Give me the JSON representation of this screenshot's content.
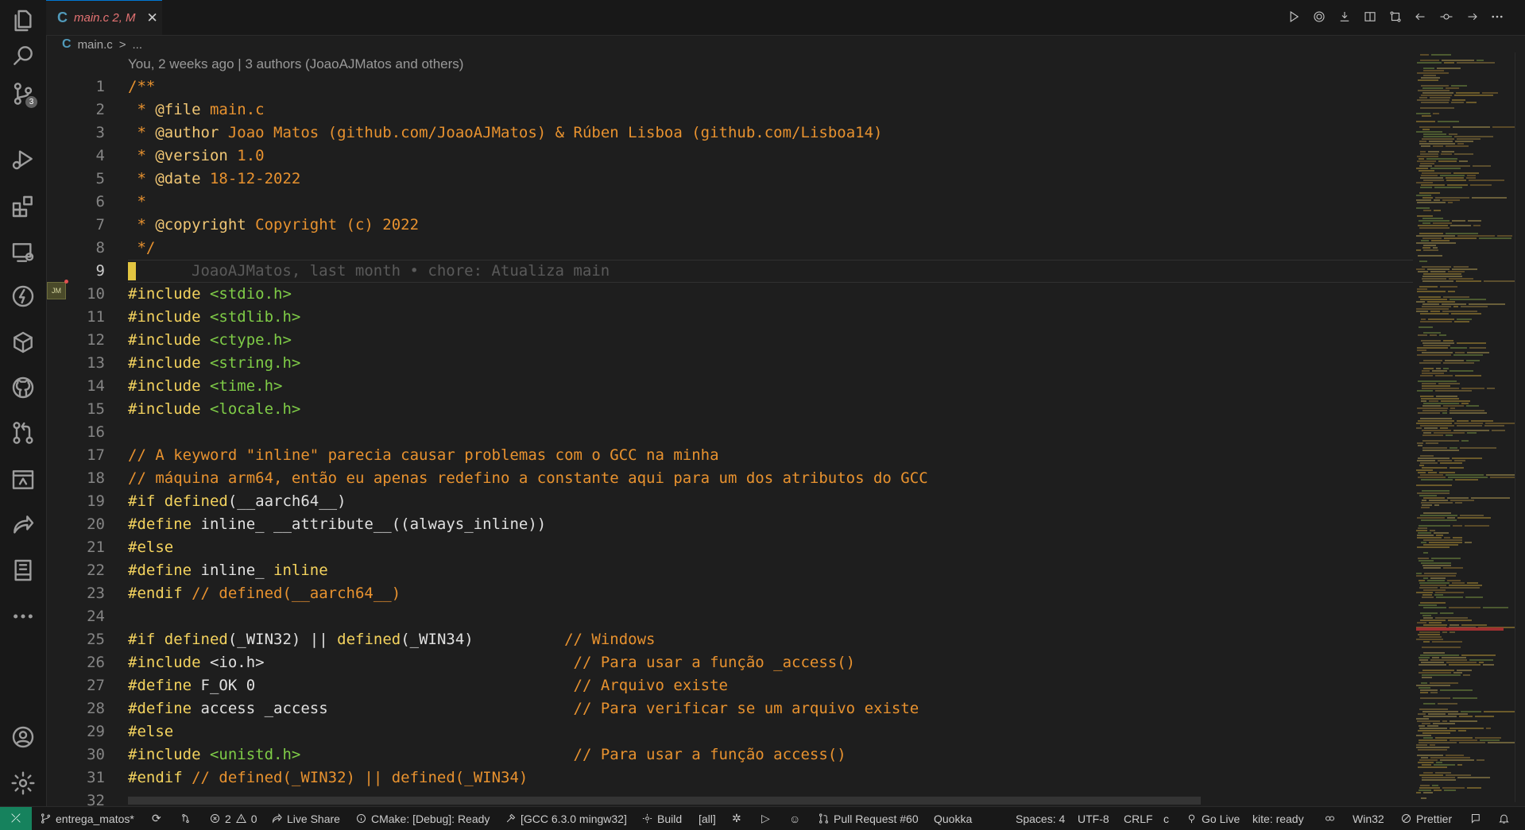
{
  "activity_bar": {
    "scm_badge": "3"
  },
  "tab": {
    "label": "main.c 2, M",
    "icon_glyph": "C",
    "close_glyph": "✕"
  },
  "breadcrumb": {
    "icon_glyph": "C",
    "file": "main.c",
    "separator": ">",
    "rest": "..."
  },
  "blame_header": "You, 2 weeks ago | 3 authors (JoaoAJMatos and others)",
  "inline_blame": "JoaoAJMatos, last month • chore: Atualiza main",
  "gutter_avatar": "JM",
  "code_lines": [
    {
      "n": "1",
      "segments": [
        {
          "t": "/**",
          "c": "cmt"
        }
      ]
    },
    {
      "n": "2",
      "segments": [
        {
          "t": " * ",
          "c": "cmt"
        },
        {
          "t": "@file",
          "c": "kw"
        },
        {
          "t": " main.c",
          "c": "cmt"
        }
      ]
    },
    {
      "n": "3",
      "segments": [
        {
          "t": " * ",
          "c": "cmt"
        },
        {
          "t": "@author",
          "c": "kw"
        },
        {
          "t": " Joao Matos (github.com/JoaoAJMatos) & Rúben Lisboa (github.com/Lisboa14)",
          "c": "cmt"
        }
      ]
    },
    {
      "n": "4",
      "segments": [
        {
          "t": " * ",
          "c": "cmt"
        },
        {
          "t": "@version",
          "c": "kw"
        },
        {
          "t": " 1.0",
          "c": "cmt"
        }
      ]
    },
    {
      "n": "5",
      "segments": [
        {
          "t": " * ",
          "c": "cmt"
        },
        {
          "t": "@date",
          "c": "kw"
        },
        {
          "t": " 18-12-2022",
          "c": "cmt"
        }
      ]
    },
    {
      "n": "6",
      "segments": [
        {
          "t": " *",
          "c": "cmt"
        }
      ]
    },
    {
      "n": "7",
      "segments": [
        {
          "t": " * ",
          "c": "cmt"
        },
        {
          "t": "@copyright",
          "c": "kw"
        },
        {
          "t": " Copyright (c) 2022",
          "c": "cmt"
        }
      ]
    },
    {
      "n": "8",
      "segments": [
        {
          "t": " */",
          "c": "cmt"
        }
      ]
    },
    {
      "n": "9",
      "segments": []
    },
    {
      "n": "10",
      "segments": [
        {
          "t": "#include",
          "c": "dir"
        },
        {
          "t": " <stdio.h>",
          "c": "inc"
        }
      ]
    },
    {
      "n": "11",
      "segments": [
        {
          "t": "#include",
          "c": "dir"
        },
        {
          "t": " <stdlib.h>",
          "c": "inc"
        }
      ]
    },
    {
      "n": "12",
      "segments": [
        {
          "t": "#include",
          "c": "dir"
        },
        {
          "t": " <ctype.h>",
          "c": "inc"
        }
      ]
    },
    {
      "n": "13",
      "segments": [
        {
          "t": "#include",
          "c": "dir"
        },
        {
          "t": " <string.h>",
          "c": "inc"
        }
      ]
    },
    {
      "n": "14",
      "segments": [
        {
          "t": "#include",
          "c": "dir"
        },
        {
          "t": " <time.h>",
          "c": "inc"
        }
      ]
    },
    {
      "n": "15",
      "segments": [
        {
          "t": "#include",
          "c": "dir"
        },
        {
          "t": " <locale.h>",
          "c": "inc"
        }
      ]
    },
    {
      "n": "16",
      "segments": []
    },
    {
      "n": "17",
      "segments": [
        {
          "t": "// A keyword \"inline\" parecia causar problemas com o GCC na minha",
          "c": "cmt"
        }
      ]
    },
    {
      "n": "18",
      "segments": [
        {
          "t": "// máquina arm64, então eu apenas redefino a constante aqui para um dos atributos do GCC",
          "c": "cmt"
        }
      ]
    },
    {
      "n": "19",
      "segments": [
        {
          "t": "#if defined",
          "c": "dir"
        },
        {
          "t": "(__aarch64__)",
          "c": "plain"
        }
      ]
    },
    {
      "n": "20",
      "segments": [
        {
          "t": "#define",
          "c": "dir"
        },
        {
          "t": " inline_ __attribute__((always_inline))",
          "c": "plain"
        }
      ]
    },
    {
      "n": "21",
      "segments": [
        {
          "t": "#else",
          "c": "dir"
        }
      ]
    },
    {
      "n": "22",
      "segments": [
        {
          "t": "#define",
          "c": "dir"
        },
        {
          "t": " inline_ ",
          "c": "plain"
        },
        {
          "t": "inline",
          "c": "dir"
        }
      ]
    },
    {
      "n": "23",
      "segments": [
        {
          "t": "#endif",
          "c": "dir"
        },
        {
          "t": " // defined(__aarch64__)",
          "c": "cmt"
        }
      ]
    },
    {
      "n": "24",
      "segments": []
    },
    {
      "n": "25",
      "segments": [
        {
          "t": "#if defined",
          "c": "dir"
        },
        {
          "t": "(_WIN32) || ",
          "c": "plain"
        },
        {
          "t": "defined",
          "c": "dir"
        },
        {
          "t": "(_WIN34)          ",
          "c": "plain"
        },
        {
          "t": "// Windows",
          "c": "cmt"
        }
      ]
    },
    {
      "n": "26",
      "segments": [
        {
          "t": "#include",
          "c": "dir"
        },
        {
          "t": " <io.h>                                  ",
          "c": "plain"
        },
        {
          "t": "// Para usar a função _access()",
          "c": "cmt"
        }
      ]
    },
    {
      "n": "27",
      "segments": [
        {
          "t": "#define",
          "c": "dir"
        },
        {
          "t": " F_OK 0                                   ",
          "c": "plain"
        },
        {
          "t": "// Arquivo existe",
          "c": "cmt"
        }
      ]
    },
    {
      "n": "28",
      "segments": [
        {
          "t": "#define",
          "c": "dir"
        },
        {
          "t": " access _access                           ",
          "c": "plain"
        },
        {
          "t": "// Para verificar se um arquivo existe",
          "c": "cmt"
        }
      ]
    },
    {
      "n": "29",
      "segments": [
        {
          "t": "#else",
          "c": "dir"
        }
      ]
    },
    {
      "n": "30",
      "segments": [
        {
          "t": "#include",
          "c": "dir"
        },
        {
          "t": " <unistd.h>                              ",
          "c": "inc"
        },
        {
          "t": "// Para usar a função access()",
          "c": "cmt"
        }
      ]
    },
    {
      "n": "31",
      "segments": [
        {
          "t": "#endif",
          "c": "dir"
        },
        {
          "t": " // defined(_WIN32) || defined(_WIN34)",
          "c": "cmt"
        }
      ]
    },
    {
      "n": "32",
      "segments": []
    }
  ],
  "status_bar": {
    "remote_glyph": "⤫",
    "branch": "entrega_matos*",
    "sync_glyph": "⟳",
    "errors": "2",
    "warnings": "0",
    "live_share": "Live Share",
    "cmake": "CMake: [Debug]: Ready",
    "kit": "[GCC 6.3.0 mingw32]",
    "build": "Build",
    "target": "[all]",
    "debug_glyph": "✲",
    "run_glyph": "▷",
    "smiley_glyph": "☺",
    "pull_request": "Pull Request #60",
    "quokka": "Quokka",
    "spaces": "Spaces: 4",
    "encoding": "UTF-8",
    "eol": "CRLF",
    "language": "c",
    "go_live": "Go Live",
    "kite": "kite: ready",
    "platform": "Win32",
    "prettier": "Prettier"
  },
  "colors": {
    "comment": "#e8922f",
    "directive": "#f4d35e",
    "include": "#7fcc47",
    "tab_modified": "#e57373",
    "remote": "#16825d"
  }
}
